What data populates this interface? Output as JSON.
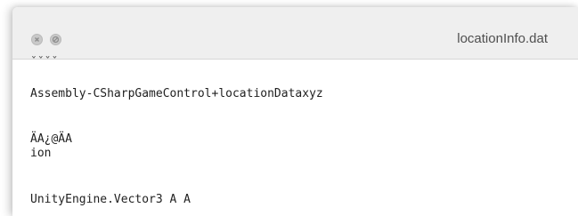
{
  "window": {
    "title": "locationInfo.dat"
  },
  "content": {
    "lines": [
      "ˇˇˇˇ",
      "Assembly-CSharpGameControl+locationDataxyz",
      "ÄA¿@ÄA",
      "ion",
      "UnityEngine.Vector3 A A"
    ]
  }
}
